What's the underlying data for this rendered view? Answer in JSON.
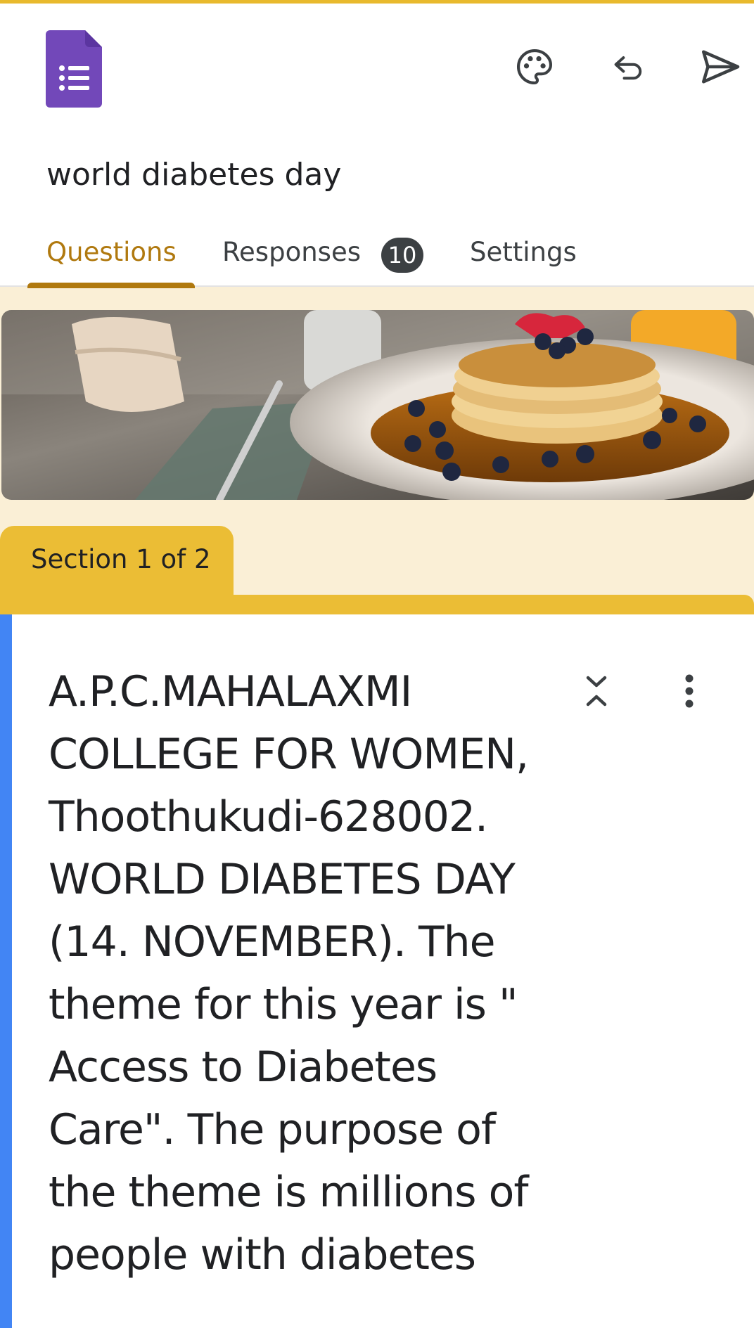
{
  "form": {
    "title": "world diabetes day"
  },
  "toolbar": {
    "icons": [
      "palette-icon",
      "undo-icon",
      "send-icon"
    ]
  },
  "tabs": {
    "questions": "Questions",
    "responses": "Responses",
    "responses_count": "10",
    "settings": "Settings"
  },
  "section": {
    "label": "Section 1 of 2"
  },
  "card": {
    "description": "A.P.C.MAHALAXMI COLLEGE FOR WOMEN, Thoothukudi-628002. WORLD DIABETES DAY (14. NOVEMBER). The theme for this year is \" Access to Diabetes Care\". The purpose of the theme is millions of people with diabetes"
  },
  "colors": {
    "accent": "#b0790f",
    "section": "#ebbd35",
    "background": "#faefd6",
    "card_accent": "#4285f4",
    "forms_purple": "#7248b9"
  }
}
